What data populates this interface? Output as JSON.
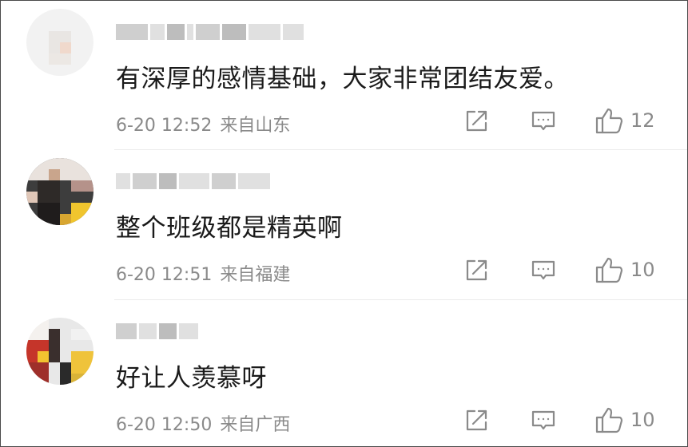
{
  "comments": [
    {
      "text": "有深厚的感情基础，大家非常团结友爱。",
      "time": "6-20 12:52",
      "location": "来自山东",
      "likes": "12",
      "icons": [
        "share-icon",
        "comment-icon",
        "thumbs-up-icon"
      ]
    },
    {
      "text": "整个班级都是精英啊",
      "time": "6-20 12:51",
      "location": "来自福建",
      "likes": "10",
      "icons": [
        "share-icon",
        "comment-icon",
        "thumbs-up-icon"
      ]
    },
    {
      "text": "好让人羡慕呀",
      "time": "6-20 12:50",
      "location": "来自广西",
      "likes": "10",
      "icons": [
        "share-icon",
        "comment-icon",
        "thumbs-up-icon"
      ]
    }
  ]
}
